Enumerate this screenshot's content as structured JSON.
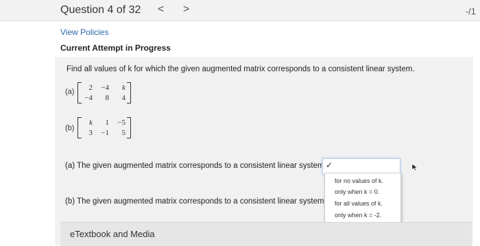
{
  "header": {
    "question_label": "Question 4 of 32",
    "prev_glyph": "<",
    "next_glyph": ">",
    "score": "-/1"
  },
  "links": {
    "view_policies": "View Policies"
  },
  "status": {
    "attempt": "Current Attempt in Progress"
  },
  "problem": {
    "prompt": "Find all values of k for which the given augmented matrix corresponds to a consistent linear system.",
    "a_label": "(a)",
    "b_label": "(b)",
    "matrix_a": [
      [
        "2",
        "−4",
        "k"
      ],
      [
        "−4",
        "8",
        "4"
      ]
    ],
    "matrix_b": [
      [
        "k",
        "1",
        "−5"
      ],
      [
        "3",
        "−1",
        "5"
      ]
    ]
  },
  "answers": {
    "a_text": "(a) The given augmented matrix corresponds to a consistent linear system",
    "b_text": "(b) The given augmented matrix corresponds to a consistent linear system",
    "selected_glyph": "✓",
    "options": [
      "for no values of k.",
      "only when k = 0.",
      "for all values of k.",
      "only when k = -2."
    ]
  },
  "footer": {
    "etextbook": "eTextbook and Media"
  },
  "icons": {
    "cursor": "mouse-pointer-icon",
    "check": "check-icon"
  }
}
